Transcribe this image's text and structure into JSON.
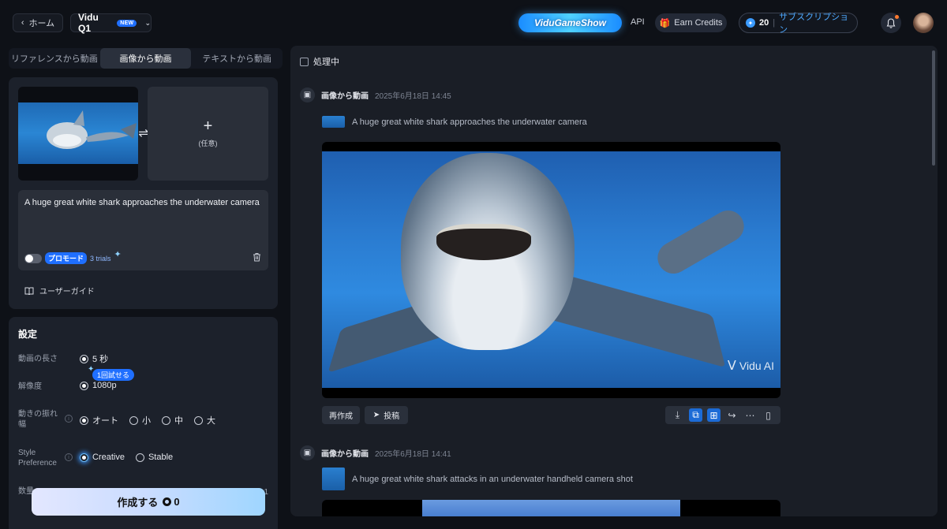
{
  "topbar": {
    "home_label": "ホーム",
    "model_name": "Vidu Q1",
    "model_badge": "NEW",
    "game_show": "ViduGameShow",
    "api_label": "API",
    "earn_label": "Earn Credits",
    "credits": "20",
    "subscription_label": "サブスクリプション"
  },
  "mode_tabs": [
    {
      "label": "リファレンスから動画",
      "active": false
    },
    {
      "label": "画像から動画",
      "active": true
    },
    {
      "label": "テキストから動画",
      "active": false
    }
  ],
  "upload": {
    "optional_label": "(任意)",
    "prompt": "A huge great white shark approaches the underwater camera",
    "pro_mode_label": "プロモード",
    "pro_trials": "3 trials",
    "guide_label": "ユーザーガイド"
  },
  "settings": {
    "title": "設定",
    "duration_label": "動画の長さ",
    "duration_value": "5 秒",
    "try_badge": "1回試せる",
    "resolution_label": "解像度",
    "resolution_value": "1080p",
    "motion_label": "動きの振れ幅",
    "motion_options": [
      {
        "label": "オート",
        "selected": true
      },
      {
        "label": "小",
        "selected": false
      },
      {
        "label": "中",
        "selected": false
      },
      {
        "label": "大",
        "selected": false
      }
    ],
    "style_label": "Style Preference",
    "style_options": [
      {
        "label": "Creative",
        "selected": true
      },
      {
        "label": "Stable",
        "selected": false
      }
    ],
    "count_label": "数量",
    "count_value": "1"
  },
  "create": {
    "label": "作成する",
    "cost": "0"
  },
  "feed": {
    "processing_label": "処理中",
    "items": [
      {
        "type": "画像から動画",
        "time": "2025年6月18日 14:45",
        "prompt": "A huge great white shark approaches the underwater camera",
        "watermark": "Vidu AI",
        "regenerate_label": "再作成",
        "post_label": "投稿"
      },
      {
        "type": "画像から動画",
        "time": "2025年6月18日 14:41",
        "prompt": "A huge great white shark attacks in an underwater handheld camera shot"
      }
    ]
  },
  "colors": {
    "accent": "#1f6fff",
    "background": "#0e1117",
    "panel": "#1c212b",
    "feed_panel": "#1a1e26"
  },
  "icons": [
    "chevron-left-icon",
    "chevron-down-icon",
    "gift-icon",
    "credit-coin-icon",
    "bell-icon",
    "swap-icon",
    "plus-icon",
    "trash-icon",
    "book-icon",
    "info-icon",
    "clip-icon",
    "send-icon",
    "download-icon",
    "extend-icon",
    "upscale-icon",
    "share-icon",
    "more-icon",
    "bookmark-icon"
  ]
}
